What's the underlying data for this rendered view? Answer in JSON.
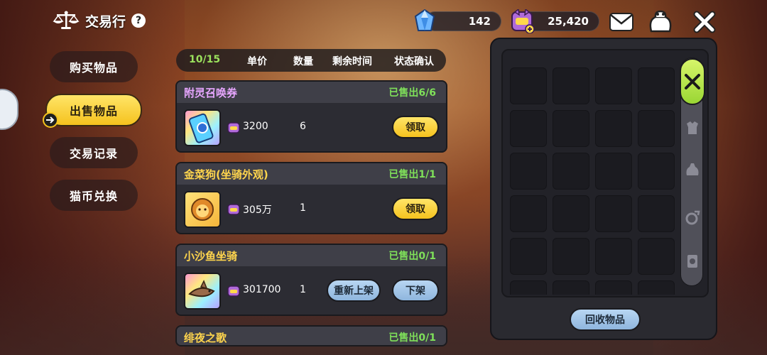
{
  "header": {
    "title": "交易行",
    "help_glyph": "?"
  },
  "currencies": {
    "gems": "142",
    "coins": "25,420"
  },
  "nav": {
    "items": [
      {
        "label": "购买物品",
        "active": false
      },
      {
        "label": "出售物品",
        "active": true
      },
      {
        "label": "交易记录",
        "active": false
      },
      {
        "label": "猫币兑换",
        "active": false
      }
    ]
  },
  "listing": {
    "count": "10/15",
    "columns": [
      "单价",
      "数量",
      "剩余时间",
      "状态确认"
    ],
    "items": [
      {
        "name": "附灵召唤券",
        "sold": "已售出6/6",
        "price": "3200",
        "qty": "6",
        "action": "领取"
      },
      {
        "name": "金菜狗(坐骑外观)",
        "sold": "已售出1/1",
        "price": "305万",
        "qty": "1",
        "action": "领取"
      },
      {
        "name": "小沙鱼坐骑",
        "sold": "已售出0/1",
        "price": "301700",
        "qty": "1",
        "relist": "重新上架",
        "delist": "下架"
      },
      {
        "name": "绯夜之歌",
        "sold": "已售出0/1"
      }
    ]
  },
  "inventory": {
    "recycle_label": "回收物品",
    "categories": [
      "weapon-icon",
      "armor-icon",
      "pouch-icon",
      "ring-icon",
      "card-icon"
    ]
  },
  "colors": {
    "accent_yellow": "#f5c21e",
    "sold_green": "#7fe05a",
    "title_purple": "#e7a6ff",
    "title_gold": "#ffd54d",
    "blue_button": "#8fb6de",
    "active_tab_green": "#9ad634"
  }
}
